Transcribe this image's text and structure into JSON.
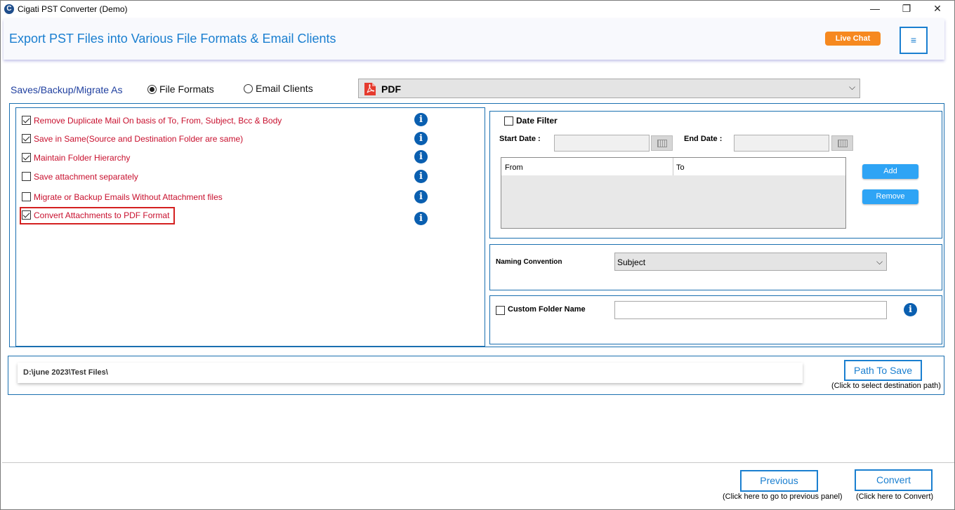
{
  "window": {
    "title": "Cigati PST Converter (Demo)",
    "minimize_glyph": "—",
    "maximize_glyph": "❐",
    "close_glyph": "✕"
  },
  "header": {
    "title": "Export PST Files into Various File Formats & Email Clients",
    "live_chat_label": "Live Chat",
    "menu_glyph": "≡"
  },
  "save_as": {
    "label": "Saves/Backup/Migrate As",
    "options": [
      {
        "label": "File Formats",
        "selected": true
      },
      {
        "label": "Email Clients",
        "selected": false
      }
    ],
    "format_value": "PDF",
    "chevron": "⌵"
  },
  "options": [
    {
      "label": "Remove Duplicate Mail On basis of To, From, Subject, Bcc & Body",
      "checked": true
    },
    {
      "label": "Save in Same(Source and Destination Folder are same)",
      "checked": true
    },
    {
      "label": "Maintain Folder Hierarchy",
      "checked": true
    },
    {
      "label": "Save attachment separately",
      "checked": false
    },
    {
      "label": "Migrate or Backup Emails Without Attachment files",
      "checked": false
    },
    {
      "label": "Convert Attachments to PDF Format",
      "checked": true
    }
  ],
  "info_glyph": "i",
  "date_filter": {
    "label": "Date Filter",
    "checked": false,
    "start_label": "Start Date :",
    "end_label": "End Date :",
    "grid_columns": [
      "From",
      "To"
    ],
    "add_label": "Add",
    "remove_label": "Remove"
  },
  "naming": {
    "label": "Naming Convention",
    "value": "Subject"
  },
  "custom_folder": {
    "label": "Custom Folder Name",
    "checked": false,
    "value": ""
  },
  "path": {
    "value": "D:\\june 2023\\Test Files\\",
    "button_label": "Path To Save",
    "hint": "(Click to select destination path)"
  },
  "footer": {
    "previous_label": "Previous",
    "previous_hint": "(Click here to go to previous panel)",
    "convert_label": "Convert",
    "convert_hint": "(Click here to Convert)"
  },
  "colors": {
    "accent": "#1a7fd0",
    "option_text": "#c8102e",
    "live_chat": "#f6891f",
    "action_button": "#2ea4f5",
    "panel_border": "#1a6fb0",
    "highlight": "#d42020"
  }
}
